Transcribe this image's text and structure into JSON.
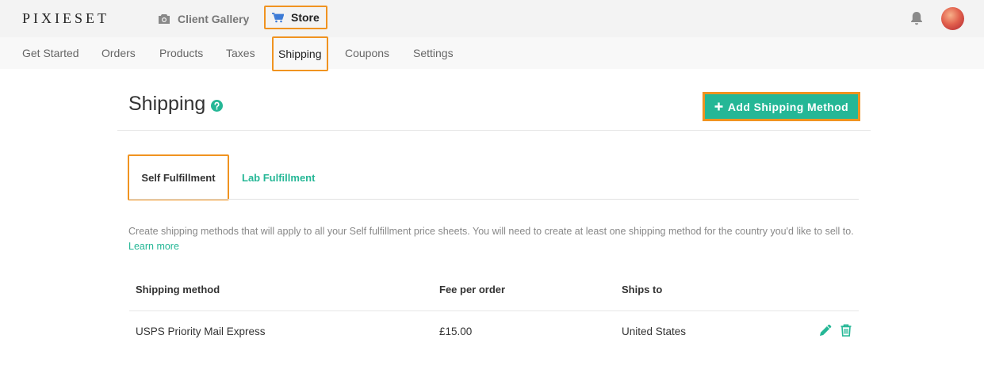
{
  "header": {
    "logo": "PIXIESET",
    "apps": [
      {
        "label": "Client Gallery",
        "icon": "camera-icon"
      },
      {
        "label": "Store",
        "icon": "cart-icon"
      }
    ],
    "icons": {
      "notifications": "bell-icon",
      "avatar": "user-avatar"
    }
  },
  "subnav": {
    "items": [
      "Get Started",
      "Orders",
      "Products",
      "Taxes",
      "Shipping",
      "Coupons",
      "Settings"
    ],
    "active": "Shipping"
  },
  "page": {
    "title": "Shipping",
    "help_icon": "question-circle-icon",
    "add_button": "Add Shipping Method",
    "add_button_icon": "plus-icon"
  },
  "tabs": [
    {
      "label": "Self Fulfillment",
      "active": true
    },
    {
      "label": "Lab Fulfillment",
      "active": false
    }
  ],
  "description": {
    "text": "Create shipping methods that will apply to all your Self fulfillment price sheets. You will need to create at least one shipping method for the country you'd like to sell to.",
    "link": "Learn more"
  },
  "table": {
    "columns": [
      "Shipping method",
      "Fee per order",
      "Ships to"
    ],
    "rows": [
      {
        "method": "USPS Priority Mail Express",
        "fee": "£15.00",
        "ships_to": "United States",
        "actions": [
          "pencil-icon",
          "trash-icon"
        ]
      }
    ]
  },
  "colors": {
    "accent": "#25b796",
    "highlight": "#f09320",
    "topbar": "#f3f3f3"
  }
}
